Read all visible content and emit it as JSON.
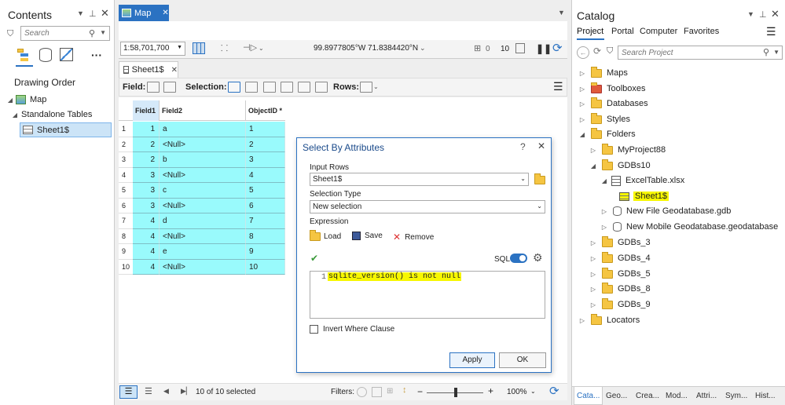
{
  "contents": {
    "title": "Contents",
    "search_placeholder": "Search",
    "drawing_order": "Drawing Order",
    "tree": {
      "map": "Map",
      "standalone": "Standalone Tables",
      "sheet": "Sheet1$"
    }
  },
  "map_tab": {
    "label": "Map"
  },
  "map_toolbar": {
    "scale": "1:58,701,700",
    "coords": "99.8977805°W 71.8384420°N",
    "selection_count": "0",
    "count10": "10"
  },
  "table_tab": {
    "label": "Sheet1$"
  },
  "table_toolbar": {
    "field_label": "Field:",
    "selection_label": "Selection:",
    "rows_label": "Rows:"
  },
  "table": {
    "columns": [
      "Field1",
      "Field2",
      "ObjectID *"
    ],
    "rows": [
      [
        "1",
        "1",
        "a",
        "1"
      ],
      [
        "2",
        "2",
        "<Null>",
        "2"
      ],
      [
        "3",
        "2",
        "b",
        "3"
      ],
      [
        "4",
        "3",
        "<Null>",
        "4"
      ],
      [
        "5",
        "3",
        "c",
        "5"
      ],
      [
        "6",
        "3",
        "<Null>",
        "6"
      ],
      [
        "7",
        "4",
        "d",
        "7"
      ],
      [
        "8",
        "4",
        "<Null>",
        "8"
      ],
      [
        "9",
        "4",
        "e",
        "9"
      ],
      [
        "10",
        "4",
        "<Null>",
        "10"
      ]
    ]
  },
  "status_bar": {
    "selected": "10 of 10 selected",
    "filters": "Filters:",
    "zoom": "100%"
  },
  "dialog": {
    "title": "Select By Attributes",
    "help": "?",
    "input_rows_label": "Input Rows",
    "input_rows_value": "Sheet1$",
    "selection_type_label": "Selection Type",
    "selection_type_value": "New selection",
    "expression_label": "Expression",
    "load": "Load",
    "save": "Save",
    "remove": "Remove",
    "sql": "SQL",
    "line_no": "1",
    "expression": "sqlite_version() is not null",
    "invert": "Invert Where Clause",
    "apply": "Apply",
    "ok": "OK"
  },
  "catalog": {
    "title": "Catalog",
    "tabs": [
      "Project",
      "Portal",
      "Computer",
      "Favorites"
    ],
    "search_placeholder": "Search Project",
    "items": {
      "maps": "Maps",
      "toolboxes": "Toolboxes",
      "databases": "Databases",
      "styles": "Styles",
      "folders": "Folders",
      "myproject": "MyProject88",
      "gdbs10": "GDBs10",
      "excel": "ExcelTable.xlsx",
      "sheet": "Sheet1$",
      "newfile": "New File Geodatabase.gdb",
      "newmobile": "New Mobile Geodatabase.geodatabase",
      "gdbs3": "GDBs_3",
      "gdbs4": "GDBs_4",
      "gdbs5": "GDBs_5",
      "gdbs8": "GDBs_8",
      "gdbs9": "GDBs_9",
      "locators": "Locators"
    },
    "bottom_tabs": [
      "Cata...",
      "Geo...",
      "Crea...",
      "Mod...",
      "Attri...",
      "Sym...",
      "Hist..."
    ]
  },
  "colors": {
    "accent": "#2b72c2",
    "highlight": "#f7f700",
    "table_cell": "#99fafc"
  }
}
